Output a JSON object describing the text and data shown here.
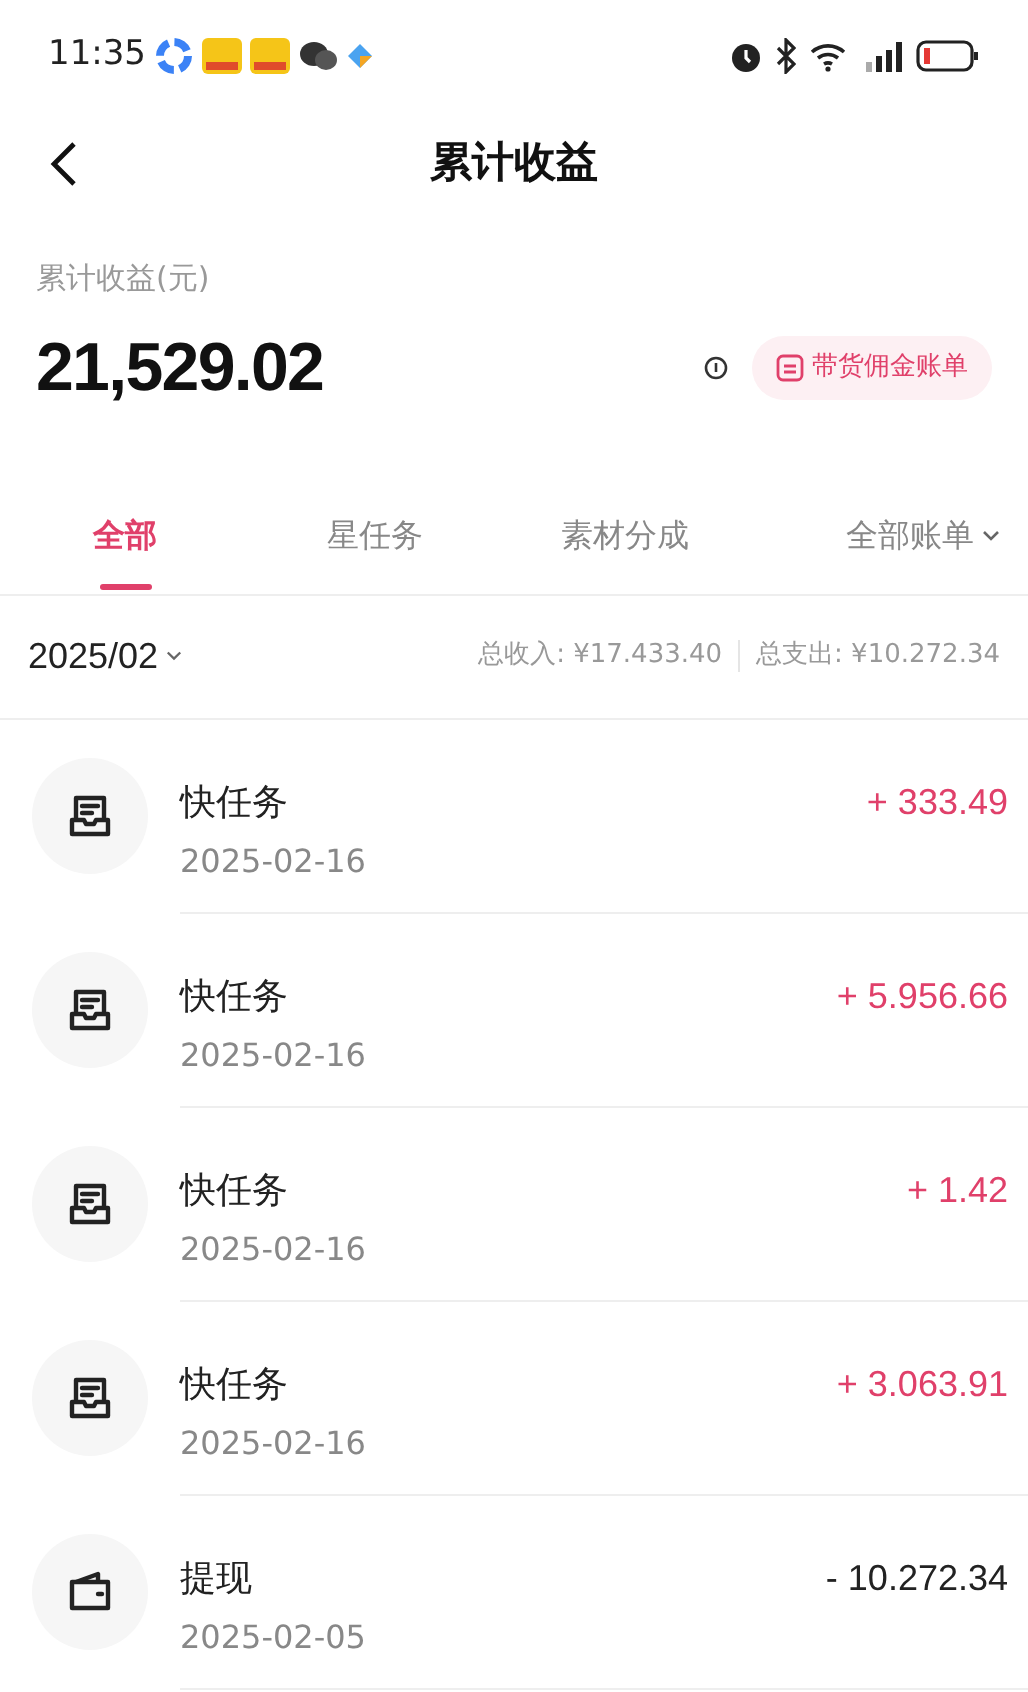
{
  "status_bar": {
    "time": "11:35"
  },
  "nav": {
    "title": "累计收益"
  },
  "summary": {
    "label": "累计收益(元)",
    "amount": "21,529.02",
    "bill_button": "带货佣金账单"
  },
  "tabs": [
    {
      "label": "全部",
      "selected": true
    },
    {
      "label": "星任务",
      "selected": false
    },
    {
      "label": "素材分成",
      "selected": false
    }
  ],
  "bill_filter": {
    "label": "全部账单"
  },
  "month_bar": {
    "month": "2025/02",
    "income": "总收入: ¥17.433.40",
    "expense": "总支出: ¥10.272.34"
  },
  "transactions": [
    {
      "kind": "task",
      "title": "快任务",
      "date": "2025-02-16",
      "amount": "+ 333.49",
      "color": "#e0406a"
    },
    {
      "kind": "task",
      "title": "快任务",
      "date": "2025-02-16",
      "amount": "+ 5.956.66",
      "color": "#e0406a"
    },
    {
      "kind": "task",
      "title": "快任务",
      "date": "2025-02-16",
      "amount": "+ 1.42",
      "color": "#e0406a"
    },
    {
      "kind": "task",
      "title": "快任务",
      "date": "2025-02-16",
      "amount": "+ 3.063.91",
      "color": "#e0406a"
    },
    {
      "kind": "wallet",
      "title": "提现",
      "date": "2025-02-05",
      "amount": "- 10.272.34",
      "color": "#222222"
    }
  ]
}
